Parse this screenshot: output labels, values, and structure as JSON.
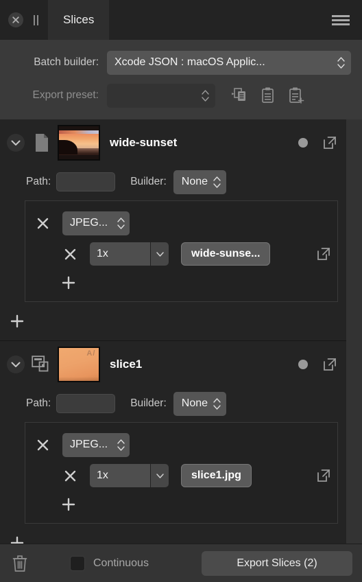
{
  "window": {
    "tab_label": "Slices",
    "close_icon": "close-circle-icon",
    "handle_icon": "pause-handle-icon",
    "menu_icon": "hamburger-menu-icon"
  },
  "settings": {
    "batch_builder_label": "Batch builder:",
    "batch_builder_value": "Xcode JSON : macOS Applic...",
    "export_preset_label": "Export preset:",
    "export_preset_value": "",
    "preset_icons": [
      {
        "name": "apply-preset-icon"
      },
      {
        "name": "copy-preset-icon"
      },
      {
        "name": "new-preset-icon"
      }
    ]
  },
  "slices": [
    {
      "name": "wide-sunset",
      "kind_icon": "document-icon",
      "thumbnail": "sunset-photo",
      "path_label": "Path:",
      "path_value": "",
      "builder_label": "Builder:",
      "builder_value": "None",
      "status": "ready",
      "exports": [
        {
          "format": "JPEG...",
          "scale": "1x",
          "filename": "wide-sunse..."
        }
      ]
    },
    {
      "name": "slice1",
      "kind_icon": "artboard-slice-icon",
      "thumbnail": "orange-gradient",
      "path_label": "Path:",
      "path_value": "",
      "builder_label": "Builder:",
      "builder_value": "None",
      "status": "ready",
      "exports": [
        {
          "format": "JPEG...",
          "scale": "1x",
          "filename": "slice1.jpg"
        }
      ]
    }
  ],
  "bottom": {
    "trash_icon": "trash-icon",
    "continuous_label": "Continuous",
    "continuous_checked": false,
    "export_button_label": "Export Slices (2)"
  },
  "colors": {
    "panel": "#3a3a3a",
    "list_bg": "#242424",
    "accent_thumb": "#f0a96f",
    "status_dot": "#9a9a9a"
  }
}
